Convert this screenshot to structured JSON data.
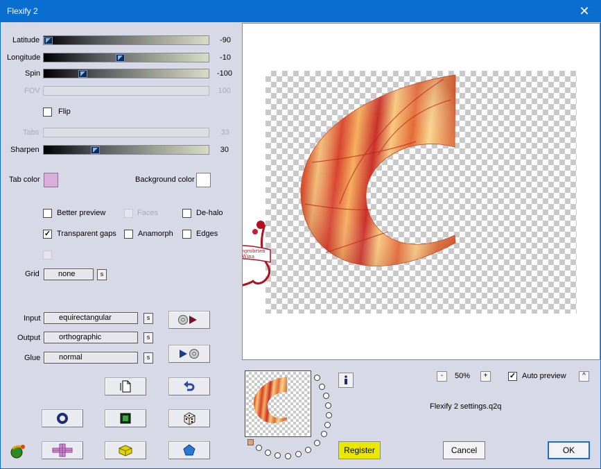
{
  "window": {
    "title": "Flexify 2",
    "close_glyph": "✕"
  },
  "sliders": [
    {
      "label": "Latitude",
      "value": "-90",
      "level": 0.0,
      "enabled": true
    },
    {
      "label": "Longitude",
      "value": "-10",
      "level": 0.46,
      "enabled": true
    },
    {
      "label": "Spin",
      "value": "-100",
      "level": 0.22,
      "enabled": true
    },
    {
      "label": "FOV",
      "value": "100",
      "level": null,
      "enabled": false
    },
    {
      "label": "Tabs",
      "value": "33",
      "level": null,
      "enabled": false
    },
    {
      "label": "Sharpen",
      "value": "30",
      "level": 0.3,
      "enabled": true
    }
  ],
  "flip": {
    "label": "Flip",
    "checked": false
  },
  "colors": {
    "tab_color_label": "Tab color",
    "tab_color": "#d9aedb",
    "background_color_label": "Background color",
    "background_color": "#ffffff"
  },
  "options": {
    "better_preview": {
      "label": "Better preview",
      "checked": false
    },
    "faces": {
      "label": "Faces",
      "checked": false,
      "enabled": false
    },
    "de_halo": {
      "label": "De-halo",
      "checked": false
    },
    "transparent_gaps": {
      "label": "Transparent gaps",
      "checked": true
    },
    "anamorph": {
      "label": "Anamorph",
      "checked": false
    },
    "edges": {
      "label": "Edges",
      "checked": false
    }
  },
  "grid": {
    "label": "Grid",
    "value": "none",
    "s_label": "s"
  },
  "mapping": {
    "input_label": "Input",
    "input_value": "equirectangular",
    "output_label": "Output",
    "output_value": "orthographic",
    "glue_label": "Glue",
    "glue_value": "normal",
    "s_label": "s"
  },
  "icons": {
    "play_left": "disc-to-play-icon",
    "play_right": "play-to-disc-icon",
    "new": "new-page-icon",
    "undo": "undo-arrow-icon",
    "ring": "ring-icon",
    "square": "square-frame-icon",
    "dice": "dice-icon",
    "cross": "cross-icon",
    "cube": "cube-icon",
    "pentagon": "pentagon-icon",
    "logo": "flexify-logo-icon",
    "info": "info-icon"
  },
  "watermark": {
    "line1": "©Rosiegrobrien",
    "line2": "Wina"
  },
  "zoom": {
    "minus": "-",
    "value": "50%",
    "plus": "+"
  },
  "auto_preview": {
    "label": "Auto preview",
    "checked": true,
    "toggle": "^"
  },
  "settings_file": "Flexify 2 settings.q2q",
  "buttons": {
    "register": "Register",
    "cancel": "Cancel",
    "ok": "OK"
  },
  "accent": {
    "title_bar": "#0a6ed0",
    "register": "#e8e800",
    "dialog_bg": "#d8d9e6"
  }
}
